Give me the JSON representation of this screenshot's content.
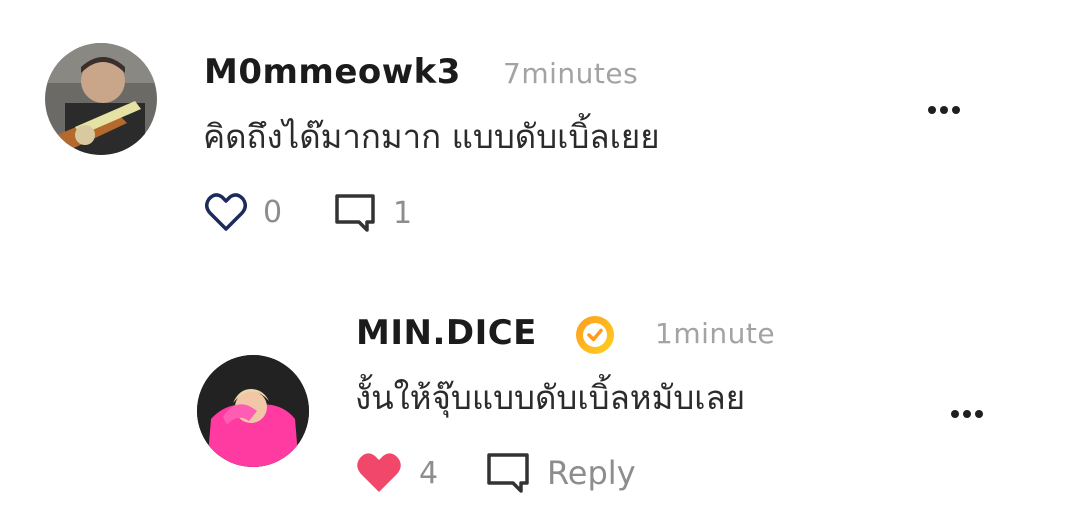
{
  "comments": [
    {
      "username": "M0mmeowk3",
      "timestamp": "7minutes",
      "text": "คิดถึงได๊มากมาก แบบดับเบิ้ลเยย",
      "likes": "0",
      "replies": "1"
    },
    {
      "username": "MIN.DICE",
      "verified": true,
      "timestamp": "1minute",
      "text": "งั้นให้จุ๊บแบบดับเบิ้ลหมับเลย",
      "likes": "4",
      "reply_label": "Reply"
    }
  ],
  "colors": {
    "like_active": "#f0476b",
    "like_outline": "#1d2a5c",
    "verified_gradient_start": "#ff9a1f",
    "verified_gradient_end": "#ffd21f"
  },
  "icons": {
    "like": "heart-icon",
    "reply": "comment-icon",
    "more": "more-options-icon",
    "verified": "verified-badge-icon"
  }
}
